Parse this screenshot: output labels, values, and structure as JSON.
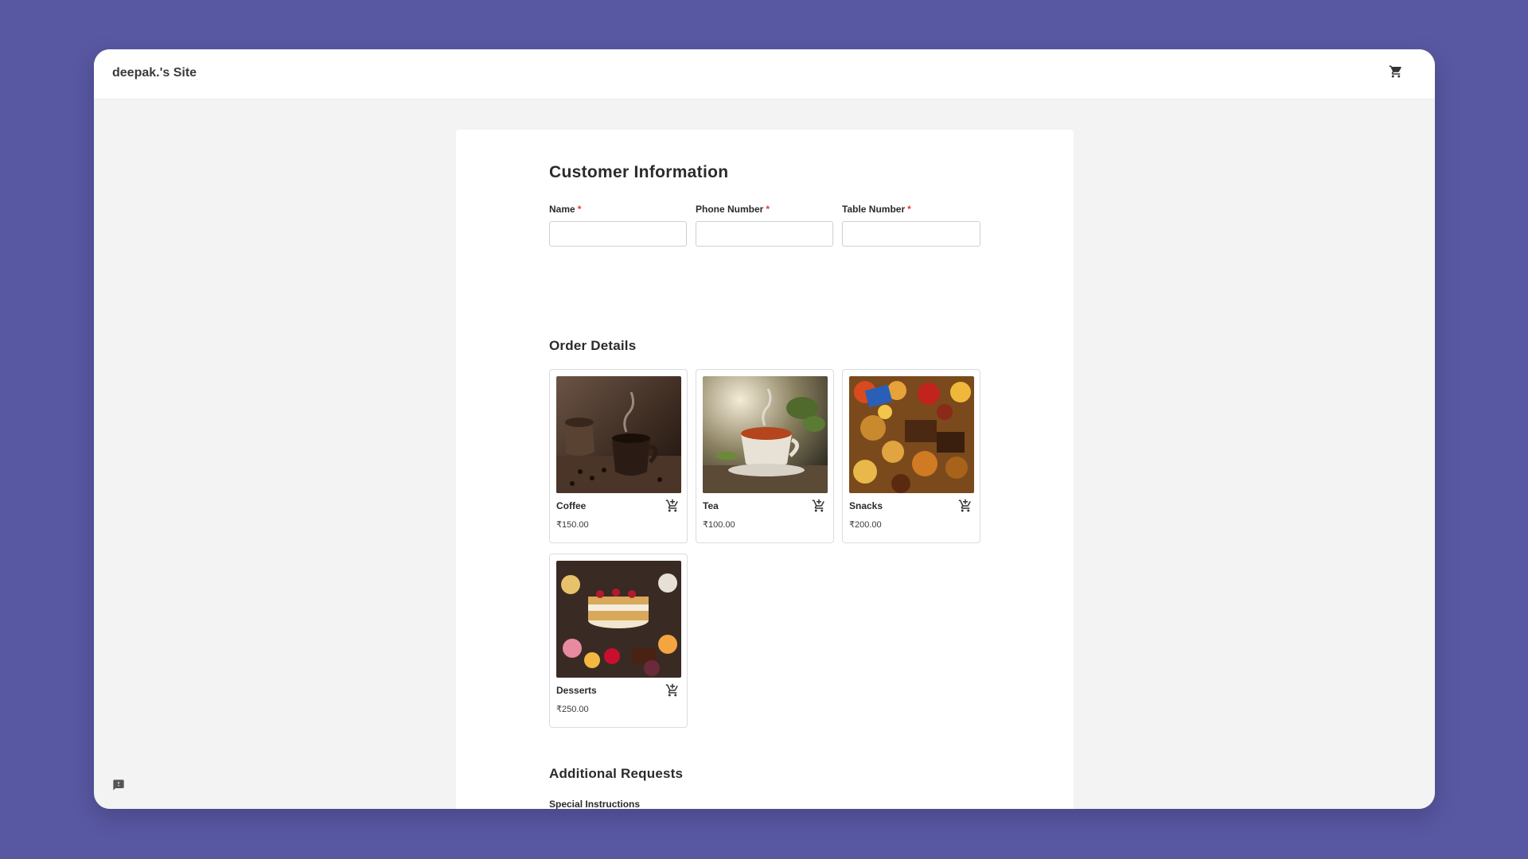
{
  "header": {
    "site_title": "deepak.'s Site",
    "cart_icon": "shopping-cart-icon"
  },
  "customer_info": {
    "title": "Customer Information",
    "required_mark": "*",
    "fields": [
      {
        "label": "Name",
        "value": ""
      },
      {
        "label": "Phone Number",
        "value": ""
      },
      {
        "label": "Table Number",
        "value": ""
      }
    ]
  },
  "order_details": {
    "title": "Order Details",
    "products": [
      {
        "name": "Coffee",
        "price": "₹150.00"
      },
      {
        "name": "Tea",
        "price": "₹100.00"
      },
      {
        "name": "Snacks",
        "price": "₹200.00"
      },
      {
        "name": "Desserts",
        "price": "₹250.00"
      }
    ]
  },
  "additional_requests": {
    "title": "Additional Requests",
    "special_instructions_label": "Special Instructions",
    "special_instructions_value": ""
  },
  "colors": {
    "background": "#5857a2",
    "required": "#e53935"
  }
}
